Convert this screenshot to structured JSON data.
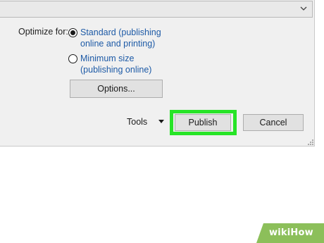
{
  "dialog": {
    "optimize_label": "Optimize for:",
    "options": [
      {
        "label_line1": "Standard (publishing",
        "label_line2": "online and printing)",
        "selected": true
      },
      {
        "label_line1": "Minimum size",
        "label_line2": "(publishing online)",
        "selected": false
      }
    ],
    "options_button": "Options...",
    "tools_label": "Tools",
    "publish_button": "Publish",
    "cancel_button": "Cancel"
  },
  "icons": {
    "dropdown": "chevron-down-icon",
    "tools_menu": "caret-down-icon",
    "resize": "resize-grip-icon"
  },
  "colors": {
    "dialog_background": "#f0f0f0",
    "option_text": "#1d5aa6",
    "highlight": "#27e427",
    "watermark": "#8cbf5a"
  },
  "watermark": {
    "wiki": "wiki",
    "how": "How"
  }
}
